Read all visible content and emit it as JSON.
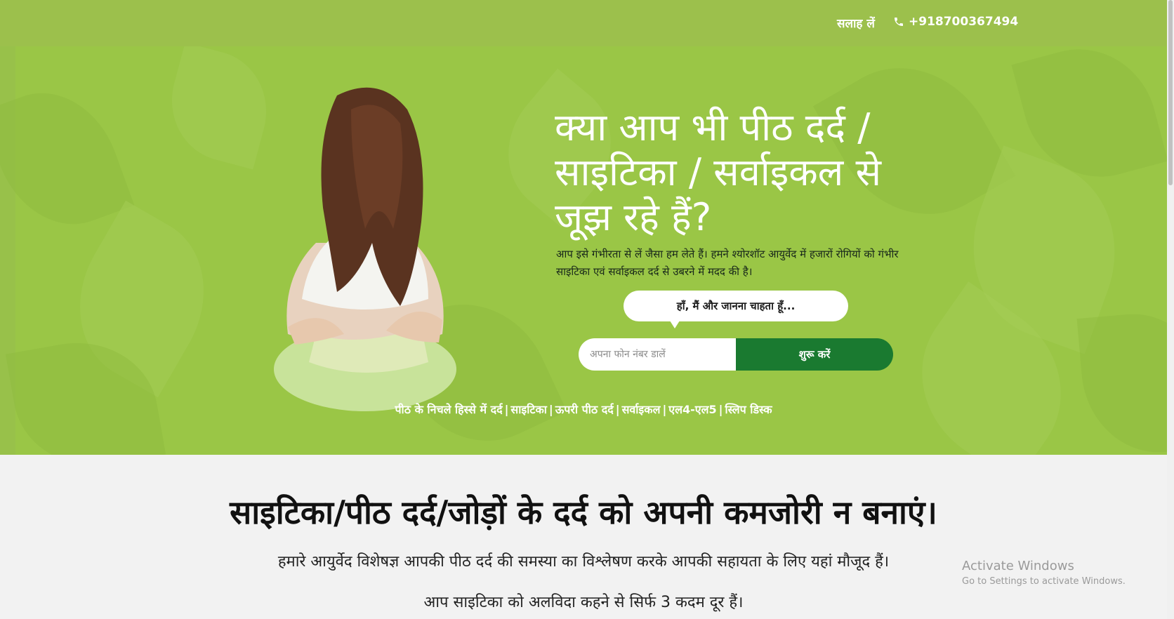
{
  "topbar": {
    "consult_label": "सलाह लें",
    "phone_label": "+918700367494"
  },
  "hero": {
    "headline": "क्या आप भी पीठ दर्द / साइटिका / सर्वाइकल से जूझ रहे हैं?",
    "subtext": "आप इसे गंभीरता से लें जैसा हम लेते हैं। हमने श्योरशॉट आयुर्वेद में हजारों रोगियों को गंभीर साइटिका एवं सर्वाइकल दर्द से उबरने में मदद की है।",
    "bubble_text": "हाँ, मैं और जानना चाहता हूँ...",
    "phone_placeholder": "अपना फोन नंबर डालें",
    "start_label": "शुरू करें",
    "tags": [
      "पीठ के निचले हिस्से में दर्द",
      "साइटिका",
      "ऊपरी पीठ दर्द",
      "सर्वाइकल",
      "एल4-एल5",
      "स्लिप डिस्क"
    ],
    "tag_separator": "|"
  },
  "section": {
    "title": "साइटिका/पीठ दर्द/जोड़ों के दर्द को अपनी कमजोरी न बनाएं।",
    "para1": "हमारे आयुर्वेद विशेषज्ञ आपकी पीठ दर्द की समस्या का विश्लेषण करके आपकी सहायता के लिए यहां मौजूद हैं।",
    "para2": "आप साइटिका को अलविदा कहने से सिर्फ 3 कदम दूर हैं।"
  },
  "watermark": {
    "line1": "Activate Windows",
    "line2": "Go to Settings to activate Windows."
  },
  "colors": {
    "topbar": "#9cc04c",
    "hero": "#9ac646",
    "button": "#1a7a30",
    "section_bg": "#f2f2f2"
  },
  "icons": {
    "phone": "phone-icon"
  }
}
